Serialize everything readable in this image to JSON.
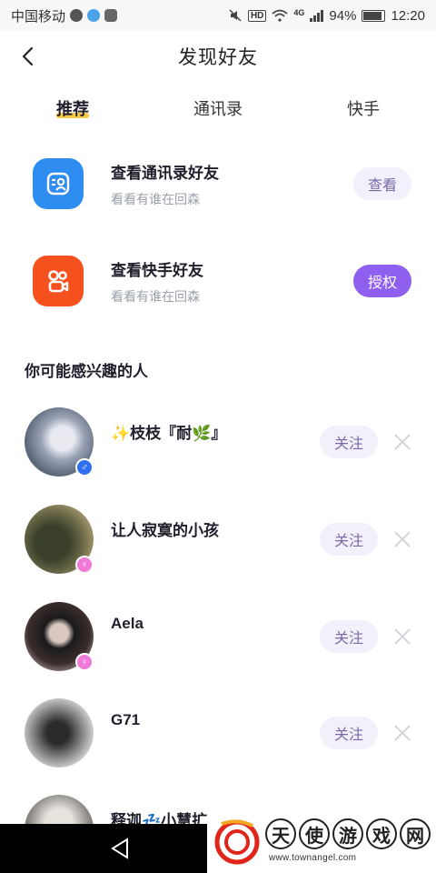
{
  "status_bar": {
    "carrier": "中国移动",
    "network": "4G",
    "hd": "HD",
    "battery": "94%",
    "time": "12:20"
  },
  "header": {
    "title": "发现好友"
  },
  "tabs": [
    {
      "label": "推荐",
      "active": true
    },
    {
      "label": "通讯录",
      "active": false
    },
    {
      "label": "快手",
      "active": false
    }
  ],
  "sources": [
    {
      "title": "查看通讯录好友",
      "subtitle": "看看有谁在回森",
      "button": "查看",
      "icon": "contacts-icon",
      "color": "#2f8cf0"
    },
    {
      "title": "查看快手好友",
      "subtitle": "看看有谁在回森",
      "button": "授权",
      "icon": "kuaishou-icon",
      "color": "#f5511e"
    }
  ],
  "section_title": "你可能感兴趣的人",
  "users": [
    {
      "name": "✨枝枝『耐🌿』",
      "gender": "♂",
      "follow": "关注"
    },
    {
      "name": "让人寂寞的小孩",
      "gender": "♀",
      "follow": "关注"
    },
    {
      "name": "Aela",
      "gender": "♀",
      "follow": "关注"
    },
    {
      "name": "G71",
      "gender": "",
      "follow": "关注"
    },
    {
      "name": "释迦💤小慧扩先『刹』",
      "gender": "",
      "follow": ""
    }
  ],
  "watermark": {
    "chars": [
      "天",
      "使",
      "游",
      "戏",
      "网"
    ],
    "url": "www.townangel.com"
  },
  "colors": {
    "accent": "#8f5ff0",
    "tab_underline": "#f7c948",
    "soft_button_bg": "#f2f0fa",
    "soft_button_text": "#7a6aa8"
  }
}
